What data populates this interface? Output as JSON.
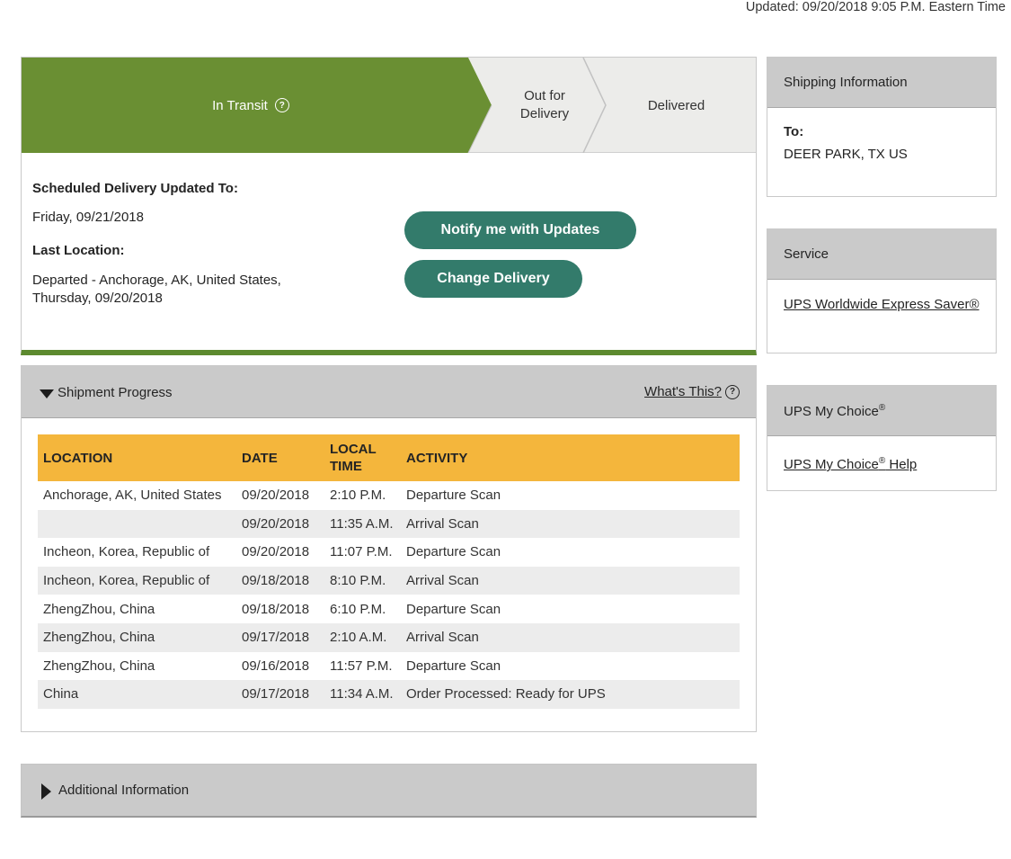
{
  "header": {
    "updated": "Updated: 09/20/2018 9:05 P.M. Eastern Time"
  },
  "status": {
    "steps": [
      "In Transit",
      "Out for Delivery",
      "Delivered"
    ],
    "active_step": 0,
    "help_symbol": "?",
    "scheduled_label": "Scheduled Delivery Updated To:",
    "scheduled_value": "Friday, 09/21/2018",
    "last_label": "Last Location:",
    "last_value": "Departed - Anchorage, AK, United States, Thursday, 09/20/2018",
    "notify_button": "Notify me with Updates",
    "change_button": "Change Delivery",
    "colors": {
      "active": "#6a8f33",
      "button": "#337b6b",
      "inactive": "#ececea"
    }
  },
  "progress": {
    "title": "Shipment Progress",
    "whats_this": "What's This?",
    "columns": [
      "LOCATION",
      "DATE",
      "LOCAL TIME",
      "ACTIVITY"
    ],
    "rows": [
      [
        "Anchorage, AK, United States",
        "09/20/2018",
        "2:10 P.M.",
        "Departure Scan"
      ],
      [
        "",
        "09/20/2018",
        "11:35 A.M.",
        "Arrival Scan"
      ],
      [
        "Incheon, Korea, Republic of",
        "09/20/2018",
        "11:07 P.M.",
        "Departure Scan"
      ],
      [
        "Incheon, Korea, Republic of",
        "09/18/2018",
        "8:10 P.M.",
        "Arrival Scan"
      ],
      [
        "ZhengZhou, China",
        "09/18/2018",
        "6:10 P.M.",
        "Departure Scan"
      ],
      [
        "ZhengZhou, China",
        "09/17/2018",
        "2:10 A.M.",
        "Arrival Scan"
      ],
      [
        "ZhengZhou, China",
        "09/16/2018",
        "11:57 P.M.",
        "Departure Scan"
      ],
      [
        "China",
        "09/17/2018",
        "11:34 A.M.",
        "Order Processed: Ready for UPS"
      ]
    ],
    "header_color": "#f4b63c"
  },
  "additional": {
    "title": "Additional Information"
  },
  "sidebar": {
    "shipping": {
      "title": "Shipping Information",
      "to_label": "To:",
      "to_value": "DEER PARK,  TX  US"
    },
    "service": {
      "title": "Service",
      "link": "UPS Worldwide Express Saver®"
    },
    "mychoice": {
      "title": "UPS My Choice",
      "reg": "®",
      "link": "UPS My Choice",
      "link_suffix": " Help"
    }
  }
}
